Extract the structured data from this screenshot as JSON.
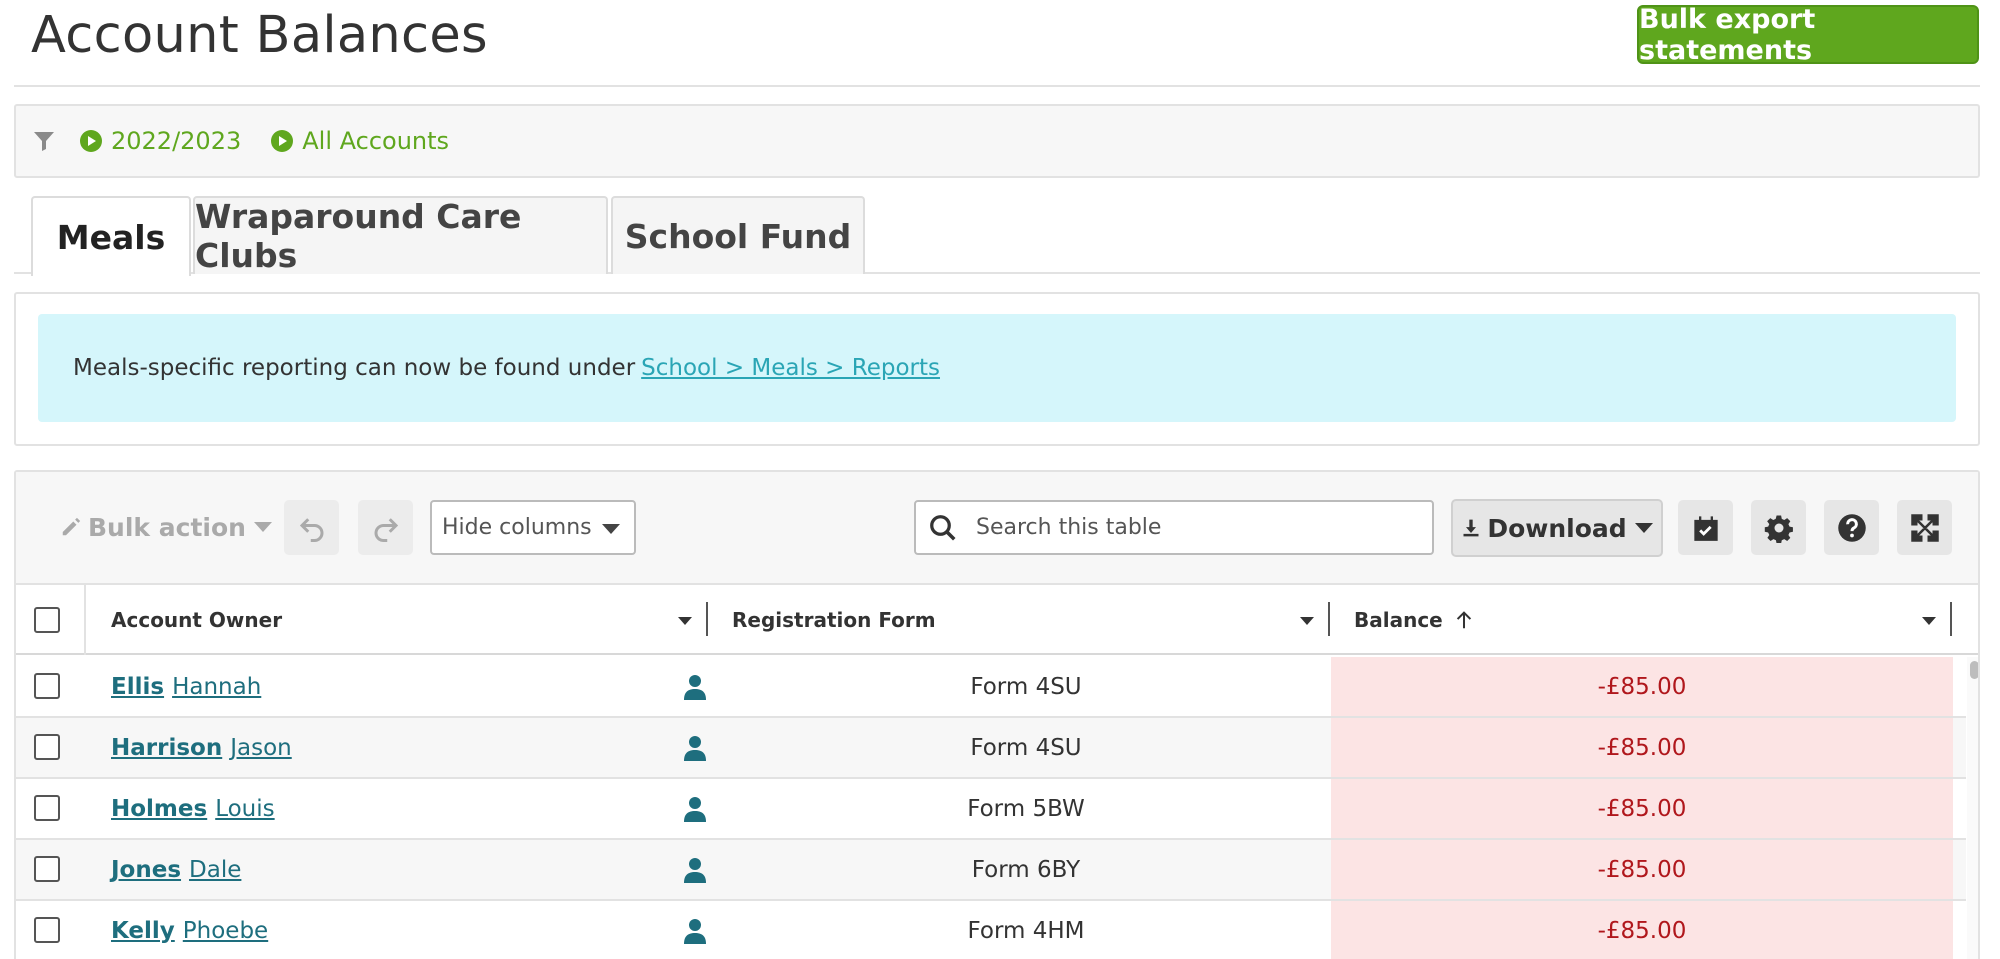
{
  "page": {
    "title": "Account Balances",
    "bulk_export_label": "Bulk export statements"
  },
  "filters": {
    "year": "2022/2023",
    "accounts": "All Accounts"
  },
  "tabs": [
    {
      "label": "Meals",
      "active": true
    },
    {
      "label": "Wraparound Care Clubs",
      "active": false
    },
    {
      "label": "School Fund",
      "active": false
    }
  ],
  "notice": {
    "text": "Meals-specific reporting can now be found under",
    "link": "School > Meals > Reports"
  },
  "toolbar": {
    "bulk_action_label": "Bulk action",
    "hide_columns_label": "Hide columns",
    "search_placeholder": "Search this table",
    "download_label": "Download"
  },
  "table": {
    "columns": {
      "owner": "Account Owner",
      "form": "Registration Form",
      "balance": "Balance"
    },
    "rows": [
      {
        "last": "Ellis",
        "first": "Hannah",
        "form": "Form 4SU",
        "balance": "-£85.00"
      },
      {
        "last": "Harrison",
        "first": "Jason",
        "form": "Form 4SU",
        "balance": "-£85.00"
      },
      {
        "last": "Holmes",
        "first": "Louis",
        "form": "Form 5BW",
        "balance": "-£85.00"
      },
      {
        "last": "Jones",
        "first": "Dale",
        "form": "Form 6BY",
        "balance": "-£85.00"
      },
      {
        "last": "Kelly",
        "first": "Phoebe",
        "form": "Form 4HM",
        "balance": "-£85.00"
      }
    ]
  },
  "colors": {
    "accent_green": "#5fa71e",
    "link_teal": "#1e6e7e",
    "notice_bg": "#d5f6fb",
    "negative_red": "#b0171c",
    "negative_bg": "#fce4e4"
  }
}
